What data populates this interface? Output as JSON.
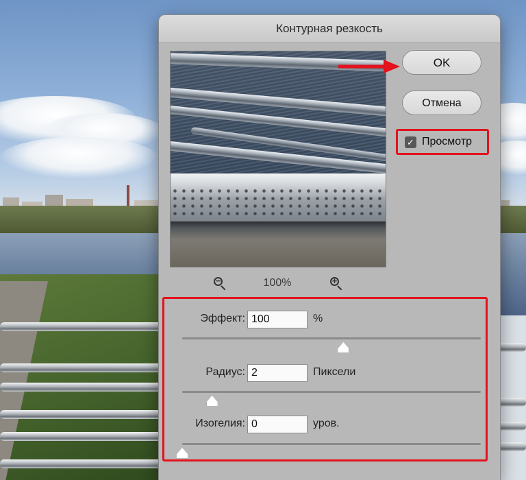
{
  "dialog": {
    "title": "Контурная резкость",
    "ok_label": "OK",
    "cancel_label": "Отмена",
    "preview_checkbox": {
      "label": "Просмотр",
      "checked": true
    },
    "zoom": {
      "value": "100%"
    }
  },
  "params": [
    {
      "label": "Эффект:",
      "value": "100",
      "unit": "%",
      "slider_fraction": 0.54
    },
    {
      "label": "Радиус:",
      "value": "2",
      "unit": "Пиксели",
      "slider_fraction": 0.1
    },
    {
      "label": "Изогелия:",
      "value": "0",
      "unit": "уров.",
      "slider_fraction": 0.0
    }
  ],
  "icons": [
    "zoom-out-icon",
    "zoom-in-icon",
    "checkmark-icon",
    "red-arrow-annotation"
  ],
  "colors": {
    "annotation": "#e3121d",
    "dialog_bg": "#b8b8b8"
  }
}
